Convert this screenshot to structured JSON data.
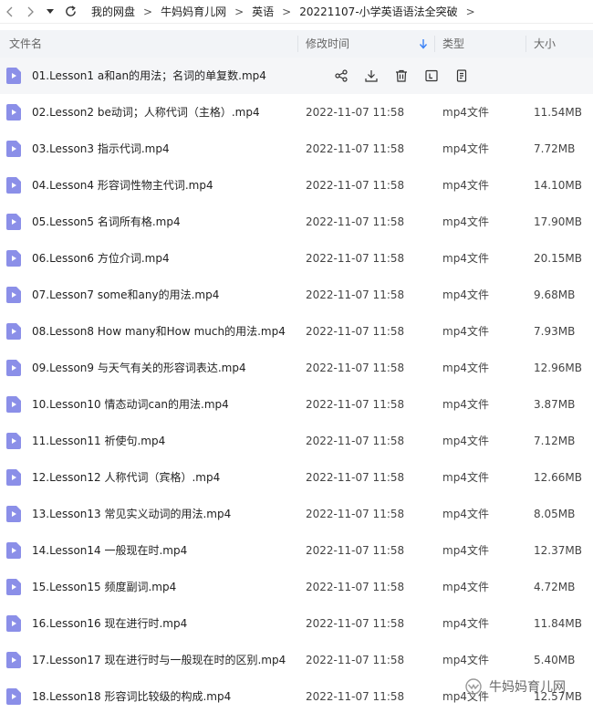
{
  "breadcrumb": [
    "我的网盘",
    "牛妈妈育儿网",
    "英语",
    "20221107-小学英语语法全突破"
  ],
  "columns": {
    "name": "文件名",
    "modified": "修改时间",
    "type": "类型",
    "size": "大小"
  },
  "files": [
    {
      "name": "01.Lesson1 a和an的用法；名词的单复数.mp4",
      "time": "",
      "type": "",
      "size": ""
    },
    {
      "name": "02.Lesson2 be动词；人称代词（主格）.mp4",
      "time": "2022-11-07 11:58",
      "type": "mp4文件",
      "size": "11.54MB"
    },
    {
      "name": "03.Lesson3 指示代词.mp4",
      "time": "2022-11-07 11:58",
      "type": "mp4文件",
      "size": "7.72MB"
    },
    {
      "name": "04.Lesson4 形容词性物主代词.mp4",
      "time": "2022-11-07 11:58",
      "type": "mp4文件",
      "size": "14.10MB"
    },
    {
      "name": "05.Lesson5 名词所有格.mp4",
      "time": "2022-11-07 11:58",
      "type": "mp4文件",
      "size": "17.90MB"
    },
    {
      "name": "06.Lesson6 方位介词.mp4",
      "time": "2022-11-07 11:58",
      "type": "mp4文件",
      "size": "20.15MB"
    },
    {
      "name": "07.Lesson7 some和any的用法.mp4",
      "time": "2022-11-07 11:58",
      "type": "mp4文件",
      "size": "9.68MB"
    },
    {
      "name": "08.Lesson8 How many和How much的用法.mp4",
      "time": "2022-11-07 11:58",
      "type": "mp4文件",
      "size": "7.93MB"
    },
    {
      "name": "09.Lesson9 与天气有关的形容词表达.mp4",
      "time": "2022-11-07 11:58",
      "type": "mp4文件",
      "size": "12.96MB"
    },
    {
      "name": "10.Lesson10 情态动词can的用法.mp4",
      "time": "2022-11-07 11:58",
      "type": "mp4文件",
      "size": "3.87MB"
    },
    {
      "name": "11.Lesson11 祈使句.mp4",
      "time": "2022-11-07 11:58",
      "type": "mp4文件",
      "size": "7.12MB"
    },
    {
      "name": "12.Lesson12 人称代词（宾格）.mp4",
      "time": "2022-11-07 11:58",
      "type": "mp4文件",
      "size": "12.66MB"
    },
    {
      "name": "13.Lesson13 常见实义动词的用法.mp4",
      "time": "2022-11-07 11:58",
      "type": "mp4文件",
      "size": "8.05MB"
    },
    {
      "name": "14.Lesson14 一般现在时.mp4",
      "time": "2022-11-07 11:58",
      "type": "mp4文件",
      "size": "12.37MB"
    },
    {
      "name": "15.Lesson15 频度副词.mp4",
      "time": "2022-11-07 11:58",
      "type": "mp4文件",
      "size": "4.72MB"
    },
    {
      "name": "16.Lesson16 现在进行时.mp4",
      "time": "2022-11-07 11:58",
      "type": "mp4文件",
      "size": "11.84MB"
    },
    {
      "name": "17.Lesson17 现在进行时与一般现在时的区别.mp4",
      "time": "2022-11-07 11:58",
      "type": "mp4文件",
      "size": "5.40MB"
    },
    {
      "name": "18.Lesson18 形容词比较级的构成.mp4",
      "time": "2022-11-07 11:58",
      "type": "mp4文件",
      "size": "12.57MB"
    }
  ],
  "watermark": "牛妈妈育儿网",
  "colors": {
    "file_icon": "#8b8fe8",
    "header_bg": "#f2f4f7",
    "sort_arrow": "#3b82f6"
  }
}
